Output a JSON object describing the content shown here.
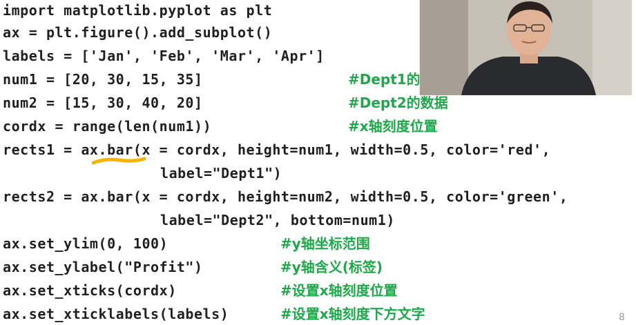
{
  "code": {
    "lines": [
      "import matplotlib.pyplot as plt",
      "ax = plt.figure().add_subplot()",
      "labels = ['Jan', 'Feb', 'Mar', 'Apr']",
      "num1 = [20, 30, 15, 35]",
      "num2 = [15, 30, 40, 20]",
      "cordx = range(len(num1))",
      "rects1 = ax.bar(x = cordx, height=num1, width=0.5, color='red',",
      "label=\"Dept1\")",
      "rects2 = ax.bar(x = cordx, height=num2, width=0.5, color='green',",
      "label=\"Dept2\", bottom=num1)",
      "ax.set_ylim(0, 100)",
      "ax.set_ylabel(\"Profit\")",
      "ax.set_xticks(cordx)",
      "ax.set_xticklabels(labels)"
    ],
    "comments": {
      "dept1": "#Dept1的",
      "dept2": "#Dept2的数据",
      "xpos": "#x轴刻度位置",
      "ylim": "#y轴坐标范围",
      "ylabel": "#y轴含义(标签)",
      "xticks": "#设置x轴刻度位置",
      "xticklabels": "#设置x轴刻度下方文字"
    }
  },
  "colors": {
    "code_text": "#202020",
    "comment": "#1fa84a",
    "highlight": "#f5b400"
  },
  "page_number": "8"
}
